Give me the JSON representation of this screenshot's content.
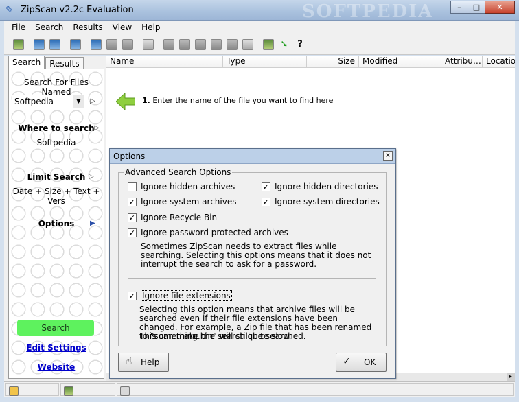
{
  "window": {
    "title": "ZipScan v2.2c Evaluation",
    "watermark": "SOFTPEDIA",
    "minimize": "–",
    "maximize": "□",
    "close": "✕"
  },
  "menu": [
    "File",
    "Search",
    "Results",
    "View",
    "Help"
  ],
  "left": {
    "tabs": [
      "Search",
      "Results"
    ],
    "search_label": "Search For Files Named",
    "search_value": "Softpedia",
    "where_label": "Where to search",
    "where_value": "Softpedia",
    "limit_label": "Limit Search",
    "limit_value": "Date + Size + Text + Vers",
    "options_label": "Options",
    "search_button": "Search",
    "edit_settings": "Edit Settings",
    "website": "Website"
  },
  "list": {
    "columns": [
      "Name",
      "Type",
      "Size",
      "Modified",
      "Attribu…",
      "Location"
    ],
    "hint_step": "1.",
    "hint_text": "Enter the name of the file you want to find here"
  },
  "dialog": {
    "title": "Options",
    "close": "x",
    "group_title": "Advanced Search Options",
    "options": [
      {
        "label": "Ignore hidden archives",
        "checked": false
      },
      {
        "label": "Ignore hidden directories",
        "checked": true
      },
      {
        "label": "Ignore system archives",
        "checked": true
      },
      {
        "label": "Ignore system directories",
        "checked": true
      },
      {
        "label": "Ignore Recycle Bin",
        "checked": true
      },
      {
        "label": "Ignore password protected archives",
        "checked": true
      },
      {
        "label": "Ignore file extensions",
        "checked": true
      }
    ],
    "desc_password": "Sometimes ZipScan needs to extract files while searching. Selecting this options means that it does not interrupt the search to ask for a password.",
    "desc_ext_1": "Selecting this option means that archive files will be searched even if their file extensions have been changed. For example, a Zip file that has been renamed to \"something.bin\" will still be searched.",
    "desc_ext_2": "This can make the search quite slow.",
    "help_button": "Help",
    "ok_button": "OK"
  }
}
